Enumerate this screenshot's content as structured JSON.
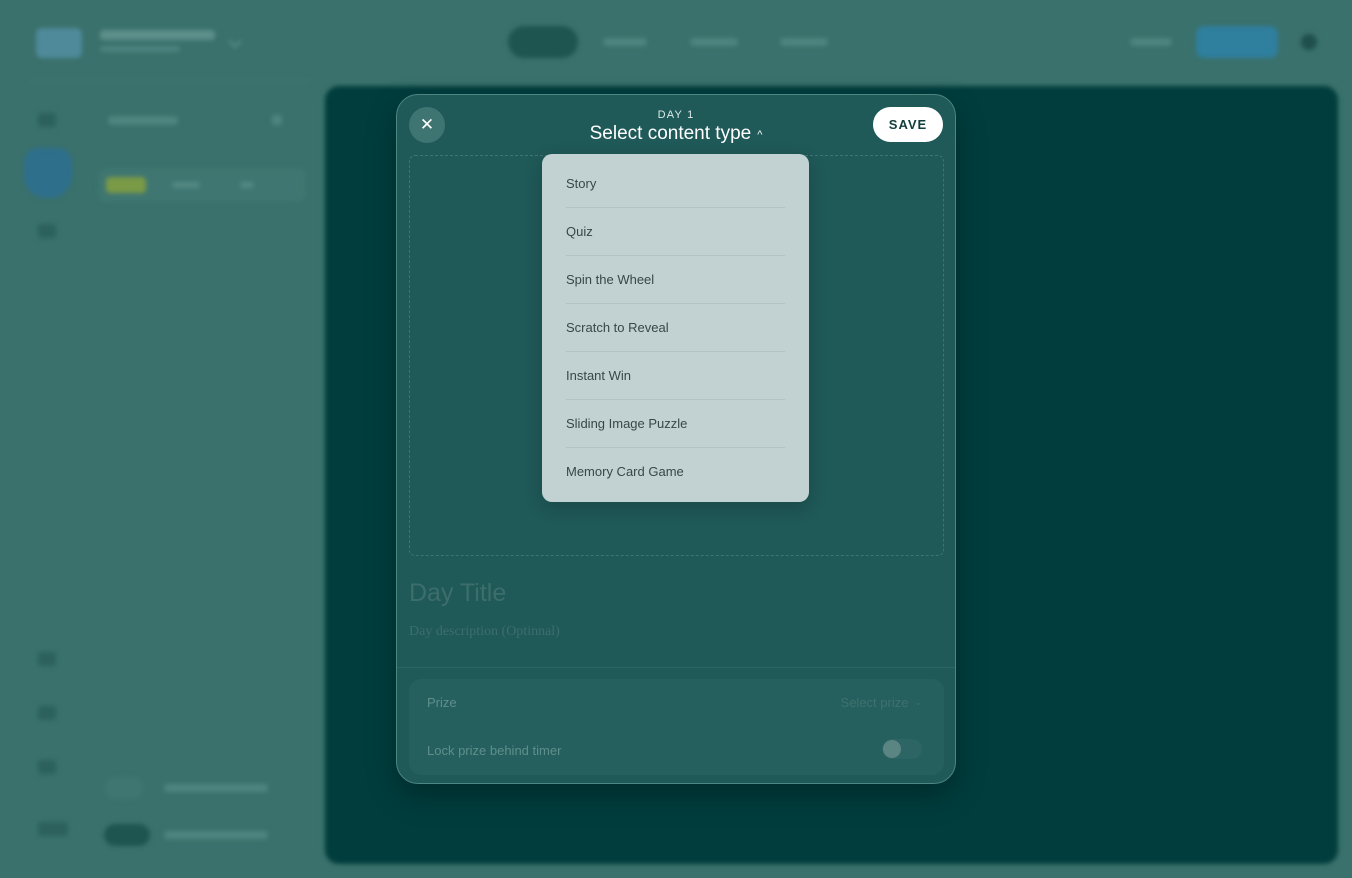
{
  "modal": {
    "day_label": "DAY 1",
    "content_type_label": "Select content type",
    "save_label": "SAVE",
    "close_glyph": "✕",
    "toggle_chevron": "^",
    "title_placeholder": "Day Title",
    "description_placeholder": "Day description (Optinnal)",
    "prize_label": "Prize",
    "prize_select_value": "Select prize",
    "prize_chevron": "⌄",
    "lock_label": "Lock prize behind timer",
    "lock_toggle_on": false
  },
  "dropdown": {
    "items": [
      "Story",
      "Quiz",
      "Spin the Wheel",
      "Scratch to Reveal",
      "Instant Win",
      "Sliding Image Puzzle",
      "Memory Card Game"
    ]
  },
  "icons": {
    "close": "close-icon",
    "chevron_up": "chevron-up-icon",
    "chevron_down": "chevron-down-icon"
  },
  "colors": {
    "overlay": "#3a716c",
    "modal_bg": "#1f5958",
    "dropdown_bg": "#c2d1d1",
    "save_bg": "#ffffff",
    "canvas_bg": "#013d3d"
  }
}
